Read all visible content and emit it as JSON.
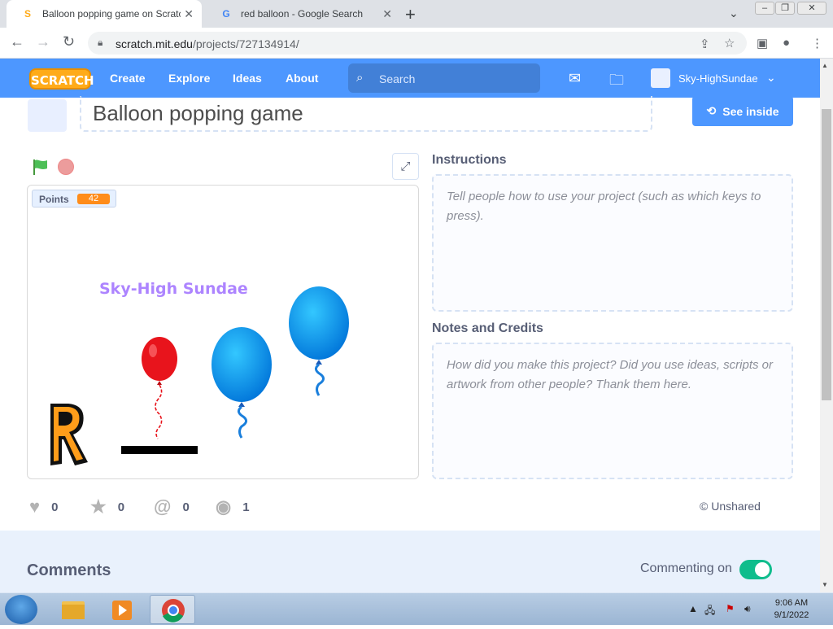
{
  "browser": {
    "tabs": [
      {
        "title": "Balloon popping game on Scratc",
        "active": true
      },
      {
        "title": "red balloon - Google Search",
        "active": false
      }
    ],
    "new_tab": "+",
    "url_domain": "scratch.mit.edu",
    "url_path": "/projects/727134914/"
  },
  "nav": {
    "logo": "SCRATCH",
    "links": [
      "Create",
      "Explore",
      "Ideas",
      "About"
    ],
    "search_placeholder": "Search",
    "username": "Sky-HighSundae"
  },
  "project": {
    "title": "Balloon popping game",
    "see_inside": "See inside",
    "stage": {
      "variable_label": "Points",
      "variable_value": "42",
      "sprite_text": "Sky-High Sundae"
    },
    "instructions_label": "Instructions",
    "instructions_placeholder": "Tell people how to use your project (such as which keys to press).",
    "notes_label": "Notes and Credits",
    "notes_placeholder": "How did you make this project? Did you use ideas, scripts or artwork from other people? Thank them here.",
    "stats": {
      "loves": "0",
      "favorites": "0",
      "remixes": "0",
      "views": "1"
    },
    "share_status": "Unshared"
  },
  "comments": {
    "title": "Comments",
    "toggle_label": "Commenting on",
    "toggle_on": true
  },
  "taskbar": {
    "time": "9:06 AM",
    "date": "9/1/2022"
  },
  "colors": {
    "scratch_blue": "#4d97ff",
    "toggle_green": "#0fbd8c",
    "points_orange": "#ff8c1a"
  }
}
